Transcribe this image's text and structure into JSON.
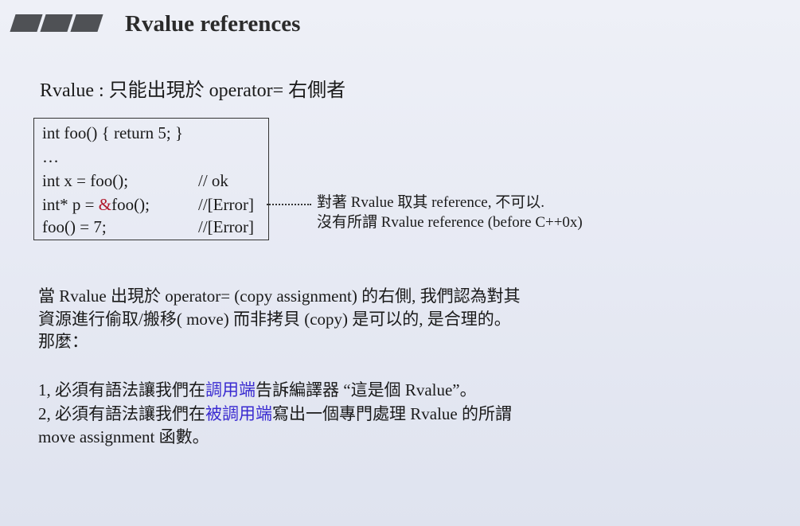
{
  "slide": {
    "title": "Rvalue references",
    "subtitle": "Rvalue : 只能出現於 operator= 右側者"
  },
  "code": {
    "lines": [
      {
        "code": "int foo() { return 5; }",
        "comment": ""
      },
      {
        "code": "…",
        "comment": ""
      },
      {
        "code": "int x = foo();",
        "comment": "// ok"
      },
      {
        "code_pre": "int* p = ",
        "code_amp": "&",
        "code_post": "foo();",
        "comment": "//[Error]"
      },
      {
        "code": "foo() = 7;",
        "comment": "//[Error]"
      }
    ]
  },
  "note": {
    "line1": "對著 Rvalue 取其 reference, 不可以.",
    "line2": "沒有所謂 Rvalue reference (before C++0x)"
  },
  "body": {
    "para1_line1": "當 Rvalue 出現於 operator= (copy assignment) 的右側, 我們認為對其",
    "para1_line2": "資源進行偷取/搬移( move) 而非拷貝 (copy) 是可以的, 是合理的。",
    "para1_line3": "那麼：",
    "item1_pre": "1, 必須有語法讓我們在",
    "item1_hl": "調用端",
    "item1_post": "告訴編譯器 “這是個 Rvalue”。",
    "item2_pre": "2, 必須有語法讓我們在",
    "item2_hl": "被調用端",
    "item2_post": "寫出一個專門處理 Rvalue 的所謂",
    "item2_line2": "move assignment 函數。"
  },
  "colors": {
    "highlight": "#3a2bd1",
    "ampersand": "#b0182b"
  }
}
